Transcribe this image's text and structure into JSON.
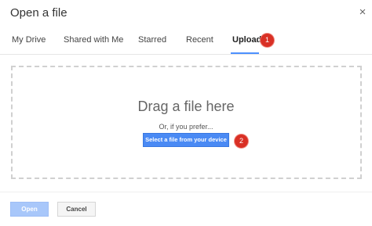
{
  "dialog": {
    "title": "Open a file",
    "close_glyph": "×"
  },
  "tabs": [
    {
      "label": "My Drive"
    },
    {
      "label": "Shared with Me"
    },
    {
      "label": "Starred"
    },
    {
      "label": "Recent"
    },
    {
      "label": "Upload",
      "active": true
    }
  ],
  "annotations": {
    "badge_1": "1",
    "badge_2": "2",
    "color": "#d93025"
  },
  "upload": {
    "drag_title": "Drag a file here",
    "or_text": "Or, if you prefer...",
    "select_button": "Select a file from your device"
  },
  "footer": {
    "open_label": "Open",
    "cancel_label": "Cancel"
  },
  "colors": {
    "accent": "#4a8af4",
    "disabled_primary": "#a8c7fa"
  }
}
